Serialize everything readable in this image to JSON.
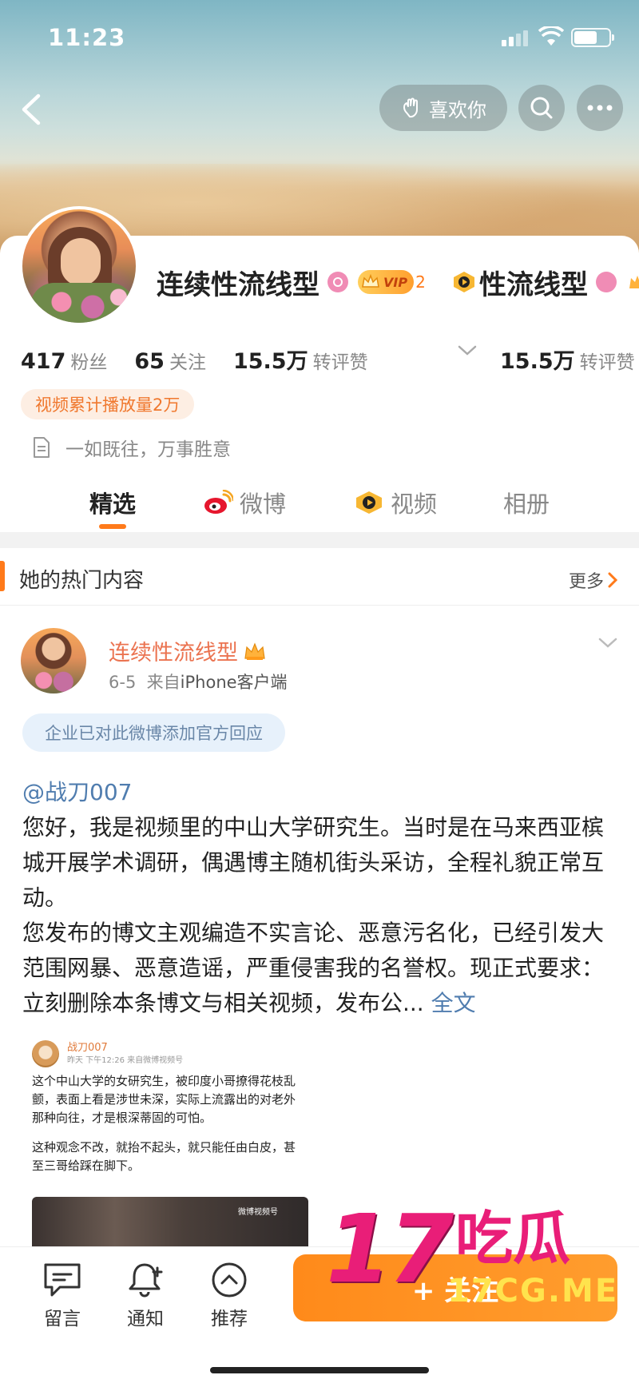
{
  "status": {
    "time": "11:23"
  },
  "header": {
    "like_label": "喜欢你"
  },
  "profile": {
    "name": "连续性流线型",
    "vip_label": "VIP",
    "vip_level": "2",
    "dup_name": "性流线型",
    "stats": [
      {
        "num": "417",
        "label": "粉丝"
      },
      {
        "num": "65",
        "label": "关注"
      },
      {
        "num": "15.5万",
        "label": "转评赞"
      }
    ],
    "dup_stat": {
      "num": "15.5万",
      "label": "转评赞"
    },
    "badge": "视频累计播放量2万",
    "bio": "一如既往，万事胜意"
  },
  "tabs": [
    {
      "label": "精选",
      "active": true
    },
    {
      "label": "微博"
    },
    {
      "label": "视频"
    },
    {
      "label": "相册"
    }
  ],
  "section": {
    "title": "她的热门内容",
    "more": "更多"
  },
  "post": {
    "author": "连续性流线型",
    "date": "6-5",
    "from_prefix": "来自",
    "source": "iPhone客户端",
    "official_notice": "企业已对此微博添加官方回应",
    "mention": "@战刀007",
    "text": "您好，我是视频里的中山大学研究生。当时是在马来西亚槟城开展学术调研，偶遇博主随机街头采访，全程礼貌正常互动。\n您发布的博文主观编造不实言论、恶意污名化，已经引发大范围网暴、恶意造谣，严重侵害我的名誉权。现正式要求：立刻删除本条博文与相关视频，发布公...",
    "more_link": "全文",
    "embed": {
      "name": "战刀007",
      "meta": "昨天 下午12:26 来自微博视频号",
      "para1": "这个中山大学的女研究生，被印度小哥撩得花枝乱颤，表面上看是涉世未深，实际上流露出的对老外那种向往，才是根深蒂固的可怕。",
      "para2": "这种观念不改，就抬不起头，就只能任由白皮，甚至三哥给踩在脚下。",
      "video_watermark": "微博视频号"
    }
  },
  "bottom_bar": {
    "items": [
      {
        "label": "留言",
        "icon": "message-icon"
      },
      {
        "label": "通知",
        "icon": "bell-plus-icon"
      },
      {
        "label": "推荐",
        "icon": "chevron-up-circle-icon"
      }
    ],
    "follow_label": "+ 关注"
  },
  "watermark": {
    "big": "17",
    "cn": "吃瓜",
    "url": "17CG.ME"
  },
  "colors": {
    "accent": "#ff7a1a",
    "link": "#507daf",
    "name_orange": "#eb7350",
    "watermark_pink": "#e91e78"
  }
}
